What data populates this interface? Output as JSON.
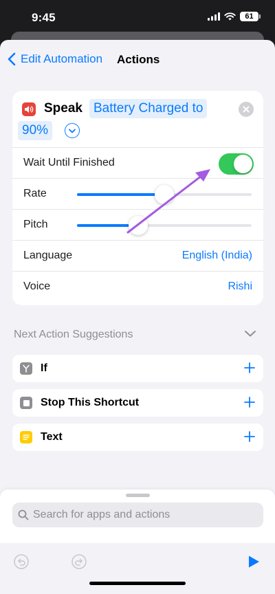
{
  "status_bar": {
    "time": "9:45",
    "battery": "61"
  },
  "nav": {
    "back_label": "Edit Automation",
    "title": "Actions"
  },
  "action": {
    "name": "Speak",
    "text_token_1": "Battery Charged to",
    "text_token_2": "90%",
    "icons": {
      "action": "speaker-icon",
      "clear": "clear-icon",
      "expand": "chevron-down-icon"
    },
    "wait_until_finished": {
      "label": "Wait Until Finished",
      "on": true
    },
    "rate": {
      "label": "Rate",
      "value": 0.5
    },
    "pitch": {
      "label": "Pitch",
      "value": 0.35
    },
    "language": {
      "label": "Language",
      "value": "English (India)"
    },
    "voice": {
      "label": "Voice",
      "value": "Rishi"
    }
  },
  "suggestions": {
    "header": "Next Action Suggestions",
    "items": [
      {
        "label": "If",
        "icon": "branch-icon",
        "color": "#8e8e93"
      },
      {
        "label": "Stop This Shortcut",
        "icon": "stop-icon",
        "color": "#8e8e93"
      },
      {
        "label": "Text",
        "icon": "text-icon",
        "color": "#ffcc00"
      }
    ]
  },
  "bottom": {
    "search_placeholder": "Search for apps and actions"
  },
  "colors": {
    "accent": "#0a7aff",
    "toggle_on": "#34c759",
    "annotation": "#a35be0"
  }
}
